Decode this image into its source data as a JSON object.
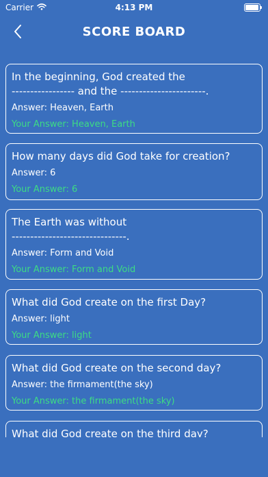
{
  "status_bar": {
    "carrier": "Carrier",
    "time": "4:13 PM"
  },
  "nav": {
    "title": "SCORE BOARD"
  },
  "labels": {
    "answer_prefix": "Answer: ",
    "your_answer_prefix": "Your Answer: "
  },
  "questions": [
    {
      "question": "In the beginning, God created the\n----------------- and the -----------------------.",
      "answer": "Answer: Heaven, Earth",
      "your_answer": "Your Answer: Heaven, Earth"
    },
    {
      "question": "How many days did God take for creation?",
      "answer": "Answer: 6",
      "your_answer": "Your Answer: 6"
    },
    {
      "question": "The Earth was without\n-------------------------------.",
      "answer": "Answer: Form and Void",
      "your_answer": "Your Answer: Form and Void"
    },
    {
      "question": "What did God create on the first Day?",
      "answer": "Answer: light",
      "your_answer": "Your Answer: light"
    },
    {
      "question": "What did God create on the second day?",
      "answer": "Answer: the firmament(the sky)",
      "your_answer": "Your Answer: the firmament(the sky)"
    },
    {
      "question": "What did God create on the third day?",
      "answer": "",
      "your_answer": ""
    }
  ],
  "colors": {
    "background": "#3a6fbe",
    "card_border": "#ffffff",
    "user_answer": "#3ddc84"
  }
}
